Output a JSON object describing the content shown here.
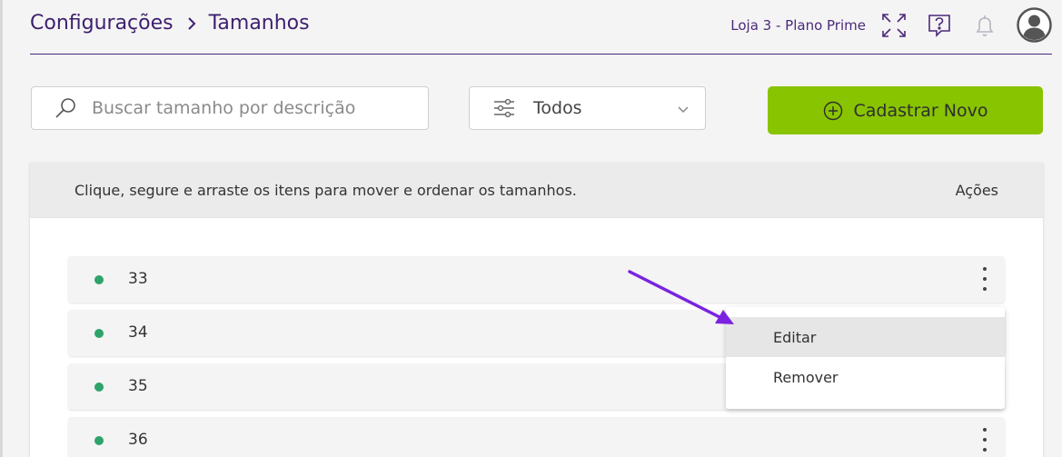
{
  "header": {
    "breadcrumb_root": "Configurações",
    "breadcrumb_current": "Tamanhos",
    "store_label": "Loja 3 - Plano Prime",
    "icons": [
      "chevron-right-icon",
      "fullscreen-icon",
      "help-icon",
      "bell-icon",
      "user-avatar-icon"
    ]
  },
  "toolbar": {
    "search_placeholder": "Buscar tamanho por descrição",
    "search_value": "",
    "filter_value": "Todos",
    "new_button_label": "Cadastrar Novo",
    "accent_color": "#88c400"
  },
  "list": {
    "hint": "Clique, segure e arraste os itens para mover e ordenar os tamanhos.",
    "actions_header": "Ações",
    "status_color": "#2ea36a",
    "items": [
      {
        "label": "33"
      },
      {
        "label": "34"
      },
      {
        "label": "35"
      },
      {
        "label": "36"
      }
    ]
  },
  "menu": {
    "edit_label": "Editar",
    "remove_label": "Remover"
  },
  "annotation": {
    "arrow_color": "#7b22e0"
  }
}
